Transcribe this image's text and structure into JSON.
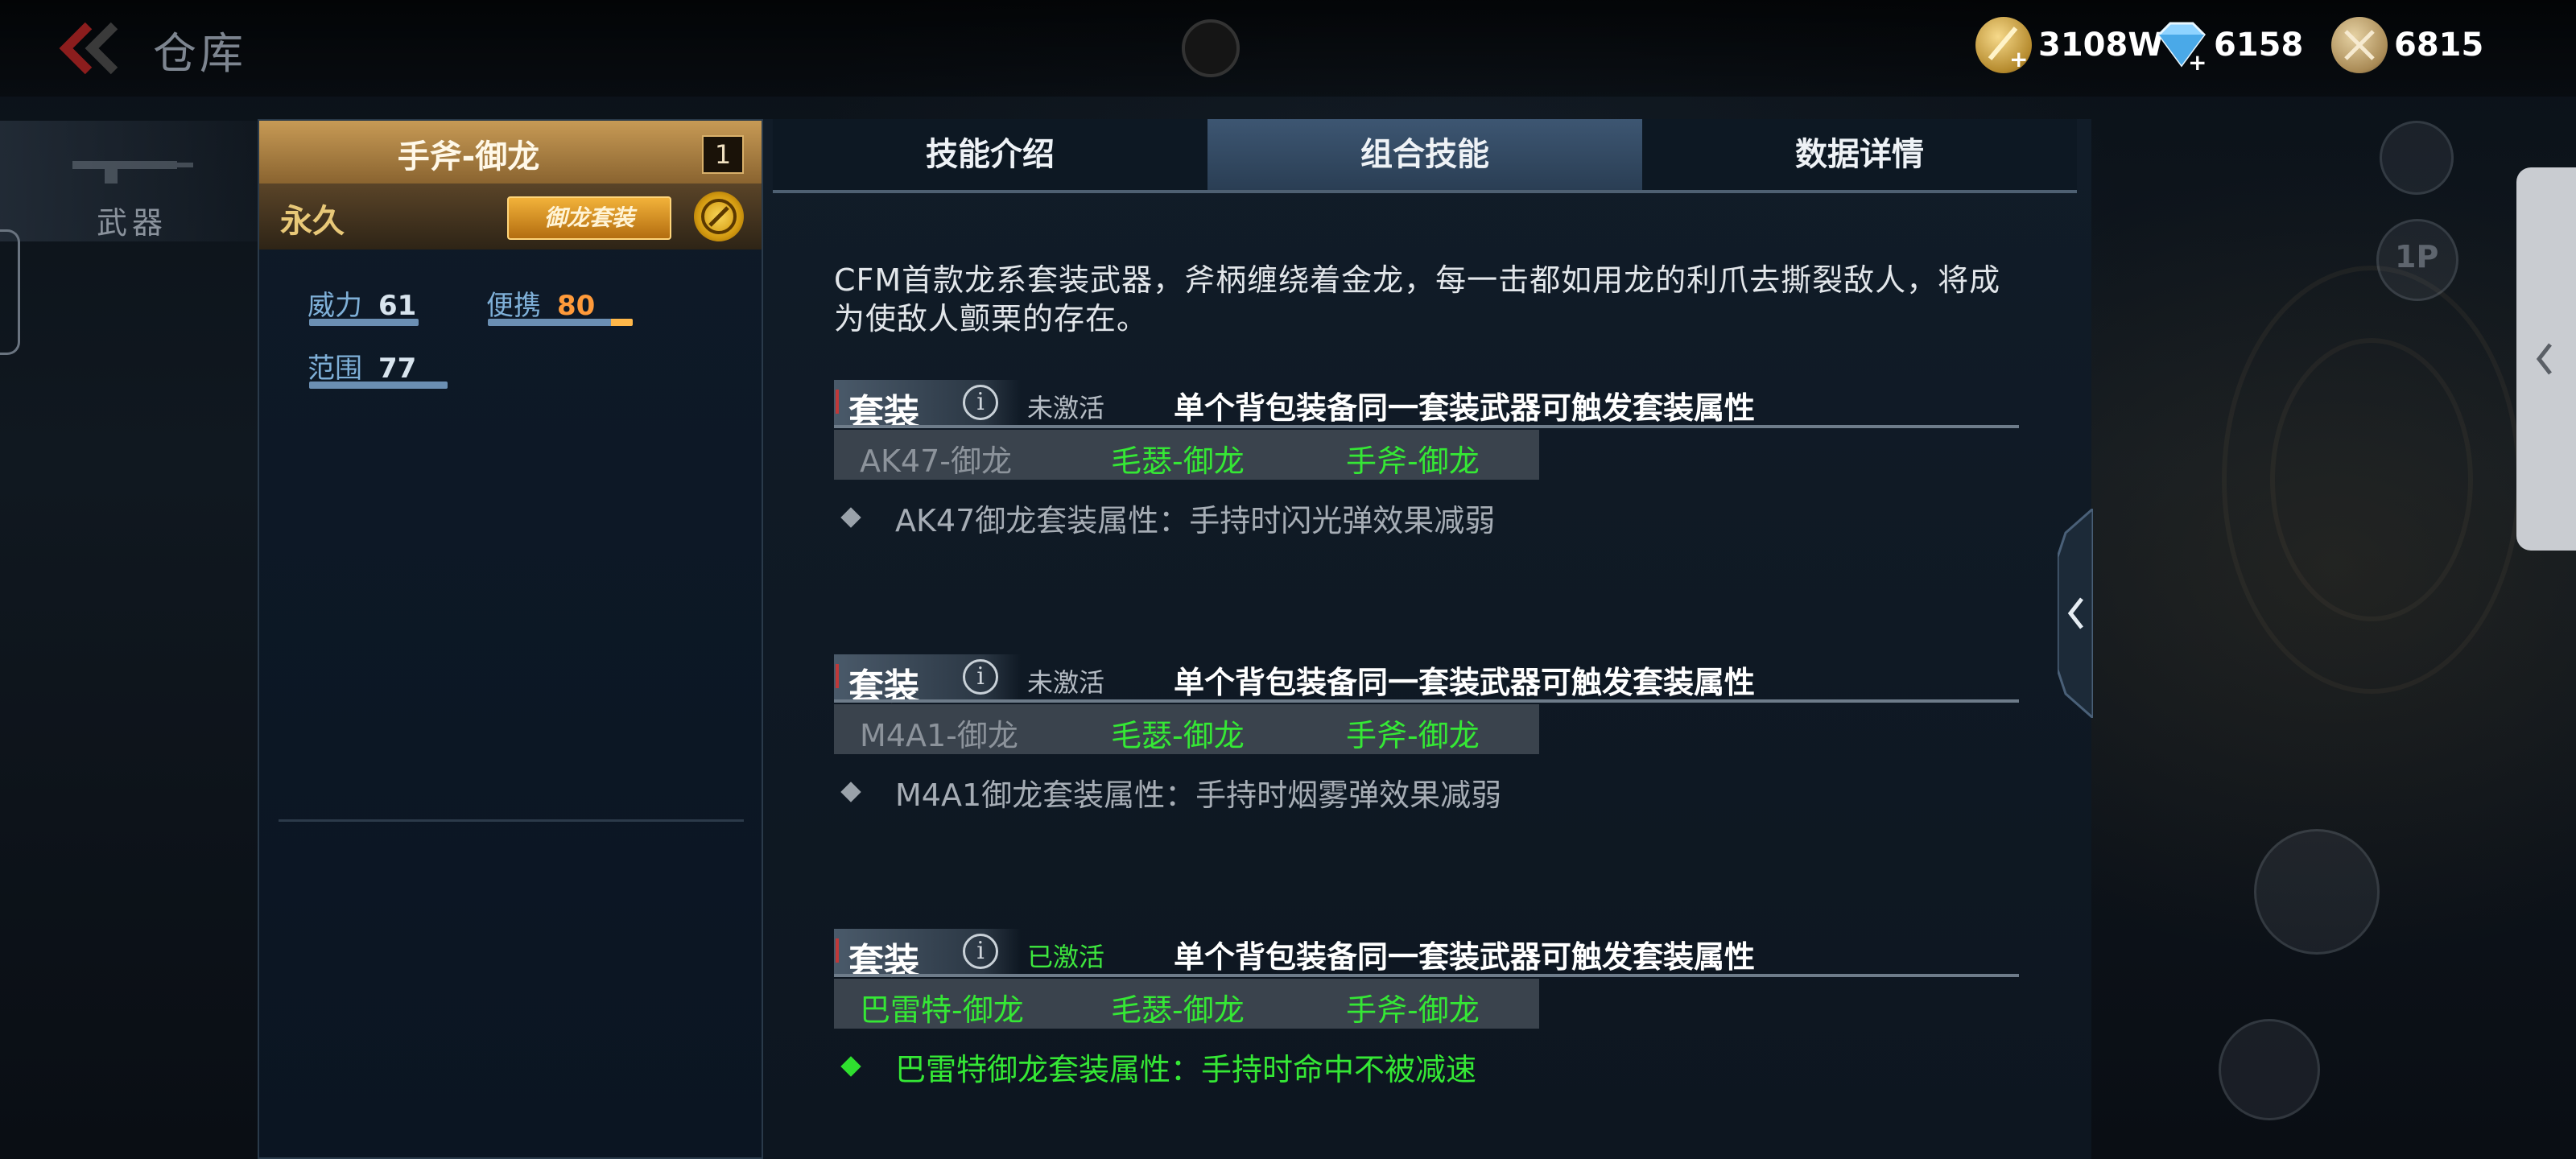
{
  "header": {
    "title": "仓库",
    "currencies": [
      {
        "name": "gold",
        "value": "3108W"
      },
      {
        "name": "diamond",
        "value": "6158"
      },
      {
        "name": "coin",
        "value": "6815"
      }
    ]
  },
  "rail": {
    "active_category": "武器"
  },
  "weapon": {
    "name": "手斧-御龙",
    "count": "1",
    "duration": "永久",
    "badge": "御龙套装",
    "stats": [
      {
        "label": "威力",
        "value": "61"
      },
      {
        "label": "便携",
        "value": "80"
      },
      {
        "label": "范围",
        "value": "77"
      }
    ]
  },
  "tabs": [
    "技能介绍",
    "组合技能",
    "数据详情"
  ],
  "active_tab": "组合技能",
  "description": "CFM首款龙系套装武器，斧柄缠绕着金龙，每一击都如用龙的利爪去撕裂敌人，将成为使敌人颤栗的存在。",
  "sets": [
    {
      "label": "套装",
      "status": "未激活",
      "rule": "单个背包装备同一套装武器可触发套装属性",
      "items": [
        "AK47-御龙",
        "毛瑟-御龙",
        "手斧-御龙"
      ],
      "effect": "AK47御龙套装属性：手持时闪光弹效果减弱"
    },
    {
      "label": "套装",
      "status": "未激活",
      "rule": "单个背包装备同一套装武器可触发套装属性",
      "items": [
        "M4A1-御龙",
        "毛瑟-御龙",
        "手斧-御龙"
      ],
      "effect": "M4A1御龙套装属性：手持时烟雾弹效果减弱"
    },
    {
      "label": "套装",
      "status": "已激活",
      "rule": "单个背包装备同一套装武器可触发套装属性",
      "items": [
        "巴雷特-御龙",
        "毛瑟-御龙",
        "手斧-御龙"
      ],
      "effect": "巴雷特御龙套装属性：手持时命中不被减速"
    }
  ],
  "hud": {
    "view_label": "1P"
  },
  "colors": {
    "active_green": "#35e835",
    "gold": "#c79a55",
    "stat_blue": "#6b8fb3",
    "orange": "#ff9a3a"
  }
}
